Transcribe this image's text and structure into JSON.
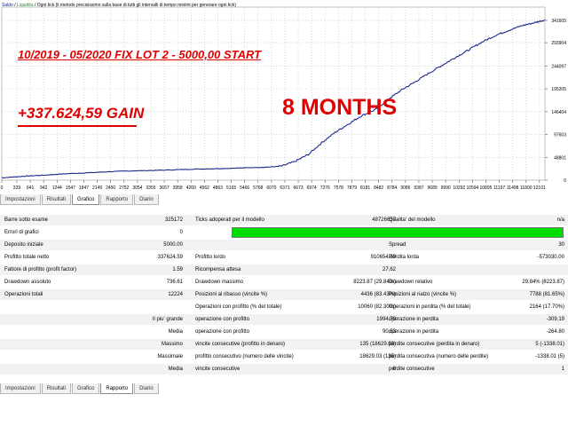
{
  "legend": {
    "balance": "Saldo",
    "equity": "Liquidita",
    "description": "Ogni tick (il metodo precisissimo sulla base di tutti gli intervalli di tempo minimi per generare ogni tick)"
  },
  "annotations": {
    "period": "10/2019 - 05/2020 FIX LOT 2  - 5000,00 START",
    "gain": "+337.624,59 GAIN",
    "months": "8 MONTHS"
  },
  "colors": {
    "balance_line": "#1b2a8c",
    "annotation_red": "#e00000",
    "green_bar": "#00dd00"
  },
  "chart_data": {
    "type": "line",
    "title": "",
    "xlabel": "",
    "ylabel": "",
    "y_ticks": [
      "341605",
      "293904",
      "244097",
      "195205",
      "146404",
      "97603",
      "48801",
      "0"
    ],
    "y_tick_values": [
      341605,
      293904,
      244097,
      195205,
      146404,
      97603,
      48801,
      0
    ],
    "x_ticks": [
      "0",
      "339",
      "641",
      "942",
      "1244",
      "1547",
      "1847",
      "2149",
      "2450",
      "2752",
      "3054",
      "3355",
      "3657",
      "3958",
      "4260",
      "4562",
      "4863",
      "5165",
      "5466",
      "5768",
      "6070",
      "6371",
      "6673",
      "6974",
      "7276",
      "7578",
      "7879",
      "8181",
      "8482",
      "8784",
      "9086",
      "9387",
      "9689",
      "9990",
      "10292",
      "10594",
      "10895",
      "11197",
      "11498",
      "11800",
      "12101"
    ],
    "ylim": [
      0,
      370000
    ],
    "xlim": [
      0,
      12224
    ],
    "series": [
      {
        "name": "Saldo",
        "x": [
          0,
          300,
          600,
          1000,
          1500,
          2000,
          2500,
          3000,
          3500,
          4000,
          4500,
          5000,
          5500,
          6000,
          6300,
          6600,
          6900,
          7200,
          7500,
          7800,
          8100,
          8400,
          8700,
          9000,
          9300,
          9600,
          9900,
          10200,
          10500,
          10800,
          11100,
          11400,
          11700,
          12000,
          12224
        ],
        "y": [
          5000,
          7000,
          9000,
          11000,
          14000,
          16000,
          18500,
          20000,
          21000,
          22500,
          24000,
          25000,
          26500,
          28000,
          30000,
          40000,
          55000,
          80000,
          102000,
          120000,
          138000,
          150000,
          173000,
          193000,
          210000,
          228000,
          245000,
          262000,
          278000,
          295000,
          309000,
          320000,
          330000,
          337000,
          342600
        ]
      }
    ],
    "grid": true
  },
  "tabs_top": [
    "Impostazioni",
    "Risultati",
    "Grafico",
    "Rapporto",
    "Diario"
  ],
  "tabs_top_active": "Grafico",
  "tabs_bottom": [
    "Impostazioni",
    "Risultati",
    "Grafico",
    "Rapporto",
    "Diario"
  ],
  "tabs_bottom_active": "Rapporto",
  "report": {
    "barre_label": "Barre sotto esame",
    "barre_value": "325172",
    "ticks_label": "Ticks adoperati per il modello",
    "ticks_value": "48726657",
    "qualita_label": "Qualita' del modello",
    "qualita_value": "n/a",
    "errori_label": "Errori di grafici",
    "errori_value": "0",
    "deposito_label": "Deposito iniziale",
    "deposito_value": "5000.00",
    "spread_label": "Spread",
    "spread_value": "30",
    "profitto_netto_label": "Profitto totale netto",
    "profitto_netto_value": "337624.59",
    "profitto_lordo_label": "Profitto lordo",
    "profitto_lordo_value": "910654.59",
    "perdita_lorda_label": "Perdita lorda",
    "perdita_lorda_value": "-573030.00",
    "fattore_label": "Fattore di profitto (profit factor)",
    "fattore_value": "1.59",
    "ricompensa_label": "Ricompensa attesa",
    "ricompensa_value": "27.62",
    "dd_assoluto_label": "Drawdown assoluto",
    "dd_assoluto_value": "736.61",
    "dd_massimo_label": "Drawdown massimo",
    "dd_massimo_value": "8223.87 (29.84%)",
    "dd_relativo_label": "Drawdown relativo",
    "dd_relativo_value": "29.84% (8223.87)",
    "op_totali_label": "Operazioni totali",
    "op_totali_value": "12224",
    "pos_ribasso_label": "Posizioni al ribasso (vincite %)",
    "pos_ribasso_value": "4436 (83.43%)",
    "pos_rialzo_label": "Posizioni al rialzo (vincite %)",
    "pos_rialzo_value": "7788 (81.65%)",
    "op_profitto_pct_label": "Operazioni con profitto (% del totale)",
    "op_profitto_pct_value": "10060 (82.30%)",
    "op_perdita_pct_label": "Operazioni in perdita (% del totale)",
    "op_perdita_pct_value": "2164 (17.70%)",
    "piu_grande_label": "Il piu' grande",
    "op_profitto_label_1": "operazione con profitto",
    "op_profitto_value_1": "1994.70",
    "op_perdita_label_1": "operazione in perdita",
    "op_perdita_value_1": "-309.19",
    "media_label_1": "Media",
    "op_profitto_label_2": "operazione con profitto",
    "op_profitto_value_2": "90.52",
    "op_perdita_label_2": "operazione in perdita",
    "op_perdita_value_2": "-264.80",
    "massimo_label": "Massimo",
    "vincite_cons_denaro_label": "vincite consecutive (profitto in denaro)",
    "vincite_cons_denaro_value": "135 (18629.03)",
    "perdite_cons_denaro_label": "perdite consecutive (perdita in denaro)",
    "perdite_cons_denaro_value": "5 (-1338.01)",
    "massimale_label": "Massimale",
    "profitto_cons_label": "profitto consecutivo (numero delle vincite)",
    "profitto_cons_value": "18629.03 (135)",
    "perdita_cons_label": "perdita consecutiva (numero delle perdite)",
    "perdita_cons_value": "-1338.01 (5)",
    "media_label_2": "Media",
    "vincite_cons_label": "vincite consecutive",
    "vincite_cons_value": "6",
    "perdite_cons_label": "perdite consecutive",
    "perdite_cons_value": "1"
  }
}
